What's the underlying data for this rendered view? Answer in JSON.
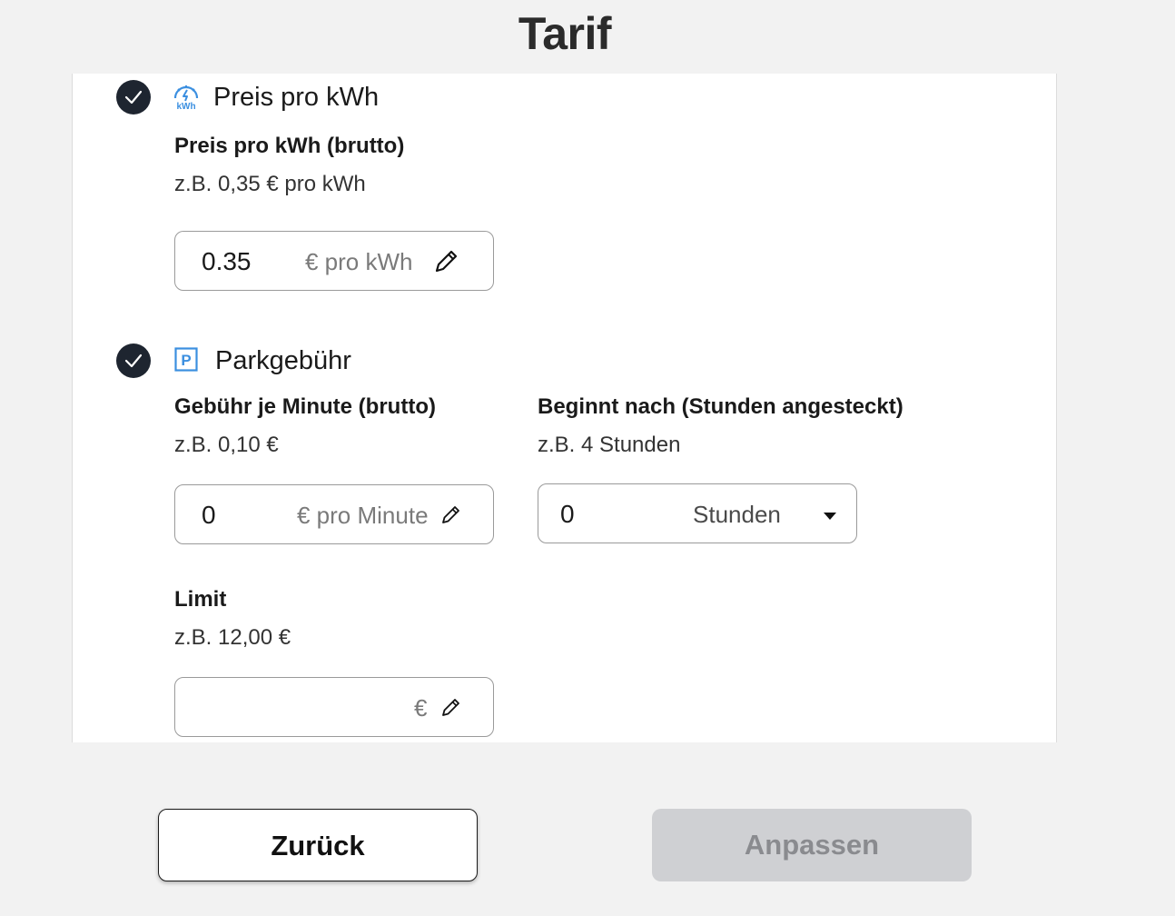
{
  "page": {
    "title": "Tarif"
  },
  "kwh_section": {
    "icon": "kwh-meter-icon",
    "icon_text": "kWh",
    "title": "Preis pro kWh",
    "field_label": "Preis pro kWh (brutto)",
    "hint": "z.B. 0,35 € pro kWh",
    "value": "0.35",
    "unit": "€ pro kWh"
  },
  "parking_section": {
    "icon": "parking-icon",
    "icon_text": "P",
    "title": "Parkgebühr",
    "fee": {
      "label": "Gebühr je Minute (brutto)",
      "hint": "z.B. 0,10 €",
      "value": "0",
      "unit": "€ pro Minute"
    },
    "start": {
      "label": "Beginnt nach (Stunden angesteckt)",
      "hint": "z.B. 4 Stunden",
      "value": "0",
      "unit": "Stunden"
    },
    "limit": {
      "label": "Limit",
      "hint": "z.B. 12,00 €",
      "value": "",
      "unit": "€"
    }
  },
  "buttons": {
    "back": "Zurück",
    "apply": "Anpassen"
  },
  "colors": {
    "accent_blue": "#3b8fe0",
    "check_bg": "#1e2530",
    "disabled_btn": "#cfd0d3"
  }
}
